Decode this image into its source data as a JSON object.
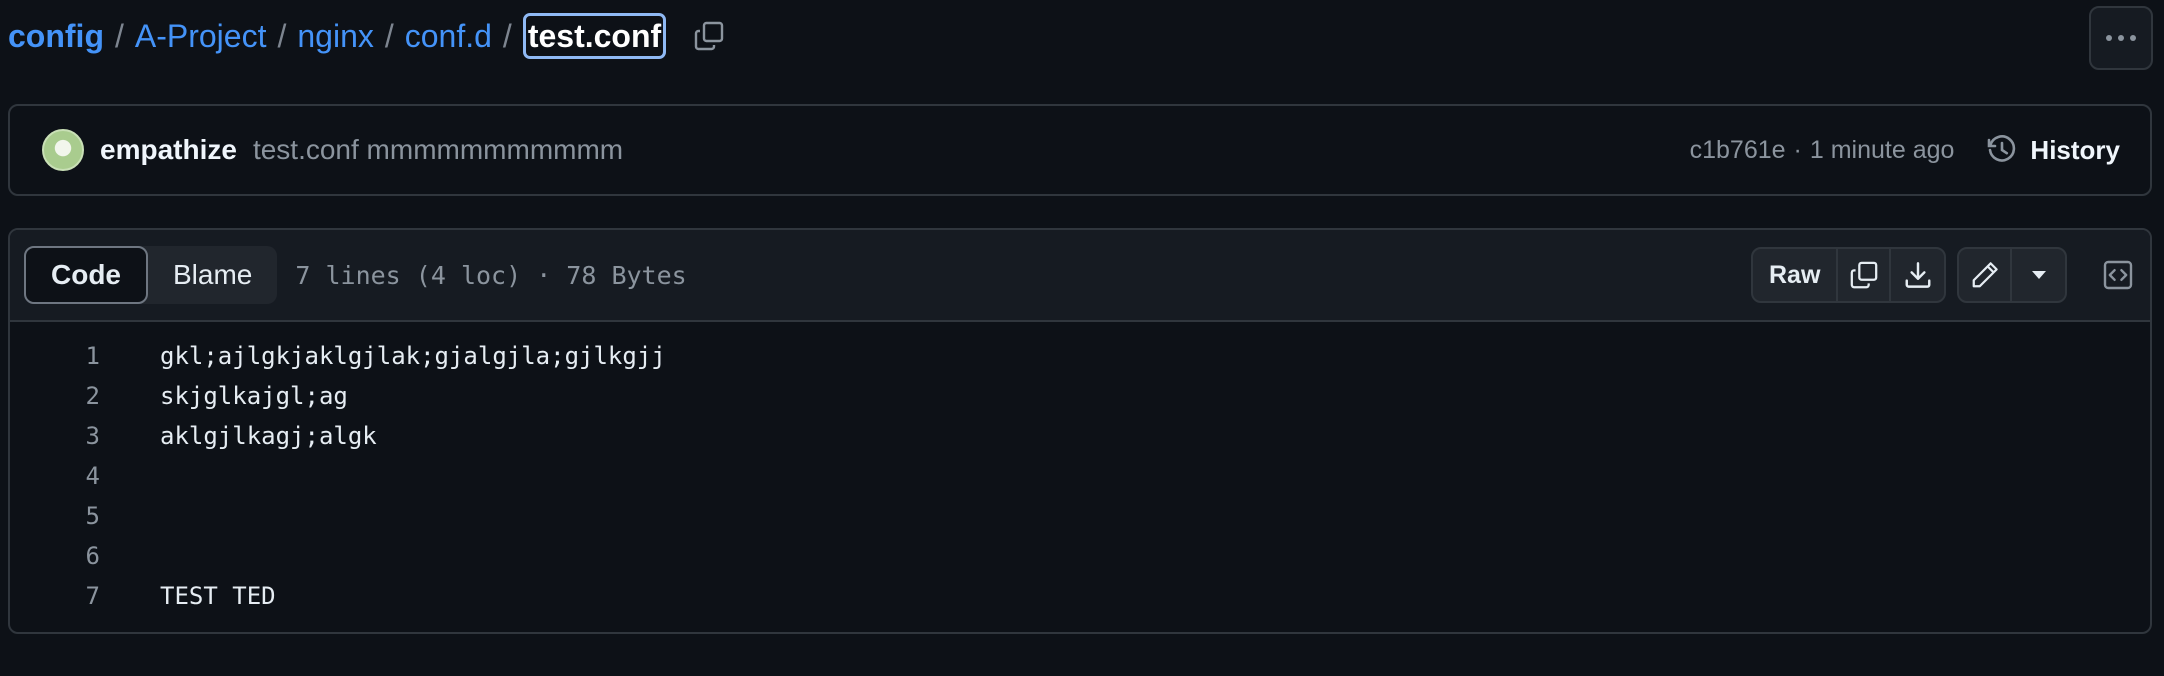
{
  "breadcrumb": {
    "root": "config",
    "segments": [
      "A-Project",
      "nginx",
      "conf.d"
    ],
    "separator": "/",
    "current": "test.conf"
  },
  "commit": {
    "author": "empathize",
    "message": "test.conf mmmmmmmmmmm",
    "hash": "c1b761e",
    "dot": "·",
    "time": "1 minute ago",
    "history_label": "History"
  },
  "file": {
    "tabs": {
      "code": "Code",
      "blame": "Blame"
    },
    "stats": "7 lines (4 loc) · 78 Bytes",
    "raw_label": "Raw",
    "lines": [
      {
        "num": "1",
        "text": "gkl;ajlgkjaklgjlak;gjalgjla;gjlkgjj"
      },
      {
        "num": "2",
        "text": "skjglkajgl;ag"
      },
      {
        "num": "3",
        "text": "aklgjlkagj;algk"
      },
      {
        "num": "4",
        "text": ""
      },
      {
        "num": "5",
        "text": ""
      },
      {
        "num": "6",
        "text": ""
      },
      {
        "num": "7",
        "text": "TEST TED"
      }
    ]
  },
  "icons": {
    "copy_path": "copy-icon",
    "more": "kebab-horizontal-icon",
    "history": "history-icon",
    "copy_raw": "copy-icon",
    "download": "download-icon",
    "edit": "pencil-icon",
    "dropdown": "triangle-down-icon",
    "symbols": "code-square-icon"
  },
  "colors": {
    "background": "#0d1117",
    "link": "#4493f8",
    "border": "#30363d",
    "muted": "#8b949e"
  }
}
